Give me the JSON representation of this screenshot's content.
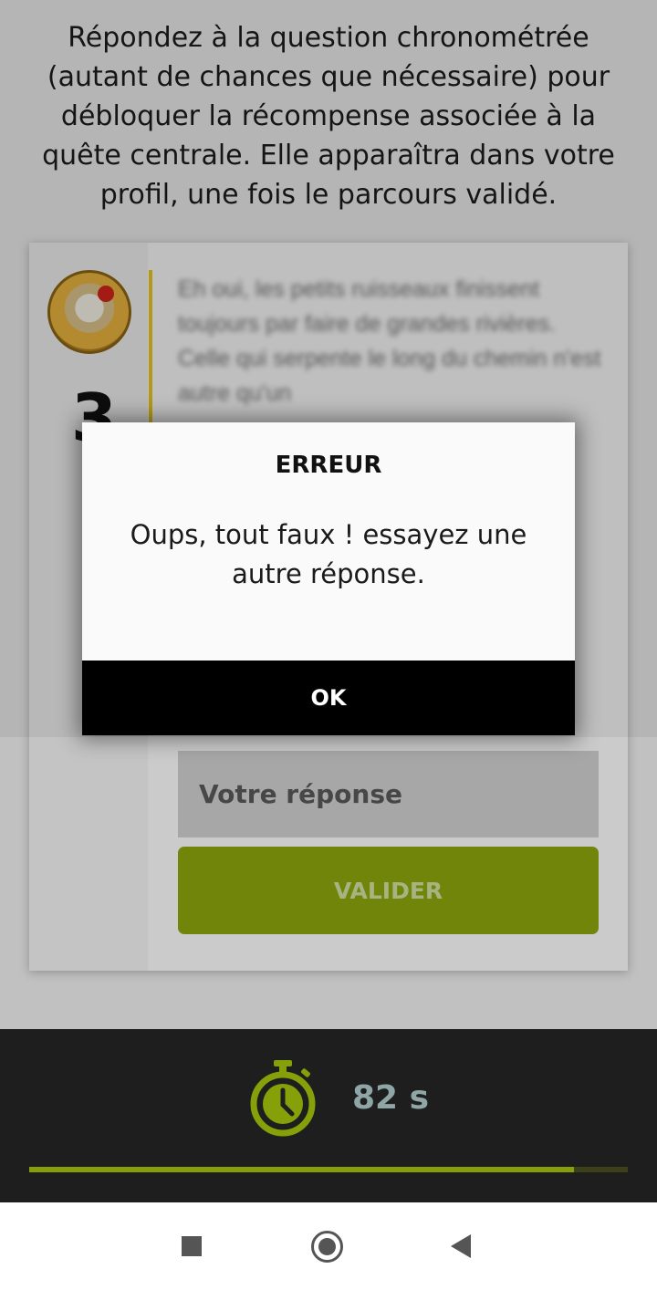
{
  "intro": {
    "text": "Répondez à la question chronométrée (autant de chances que nécessaire) pour débloquer la récompense associée à la quête centrale. Elle apparaîtra dans votre profil, une fois le parcours validé."
  },
  "card": {
    "step_number": "3",
    "story_text": "Eh oui, les petits ruisseaux finissent toujours par faire de grandes rivières. Celle qui serpente le long du chemin n'est autre qu'un",
    "answer_placeholder": "Votre réponse",
    "validate_label": "VALIDER",
    "accent_color": "#e7c51e",
    "button_color": "#8aa00e"
  },
  "timer": {
    "icon": "stopwatch-icon",
    "value": "82 s",
    "progress_fraction": 0.91,
    "progress_color": "#86a00a"
  },
  "dialog": {
    "title": "ERREUR",
    "message": "Oups, tout faux ! essayez une autre réponse.",
    "ok_label": "OK"
  },
  "nav": {
    "recent_icon": "square-recent-apps-icon",
    "home_icon": "circle-home-icon",
    "back_icon": "triangle-back-icon"
  }
}
